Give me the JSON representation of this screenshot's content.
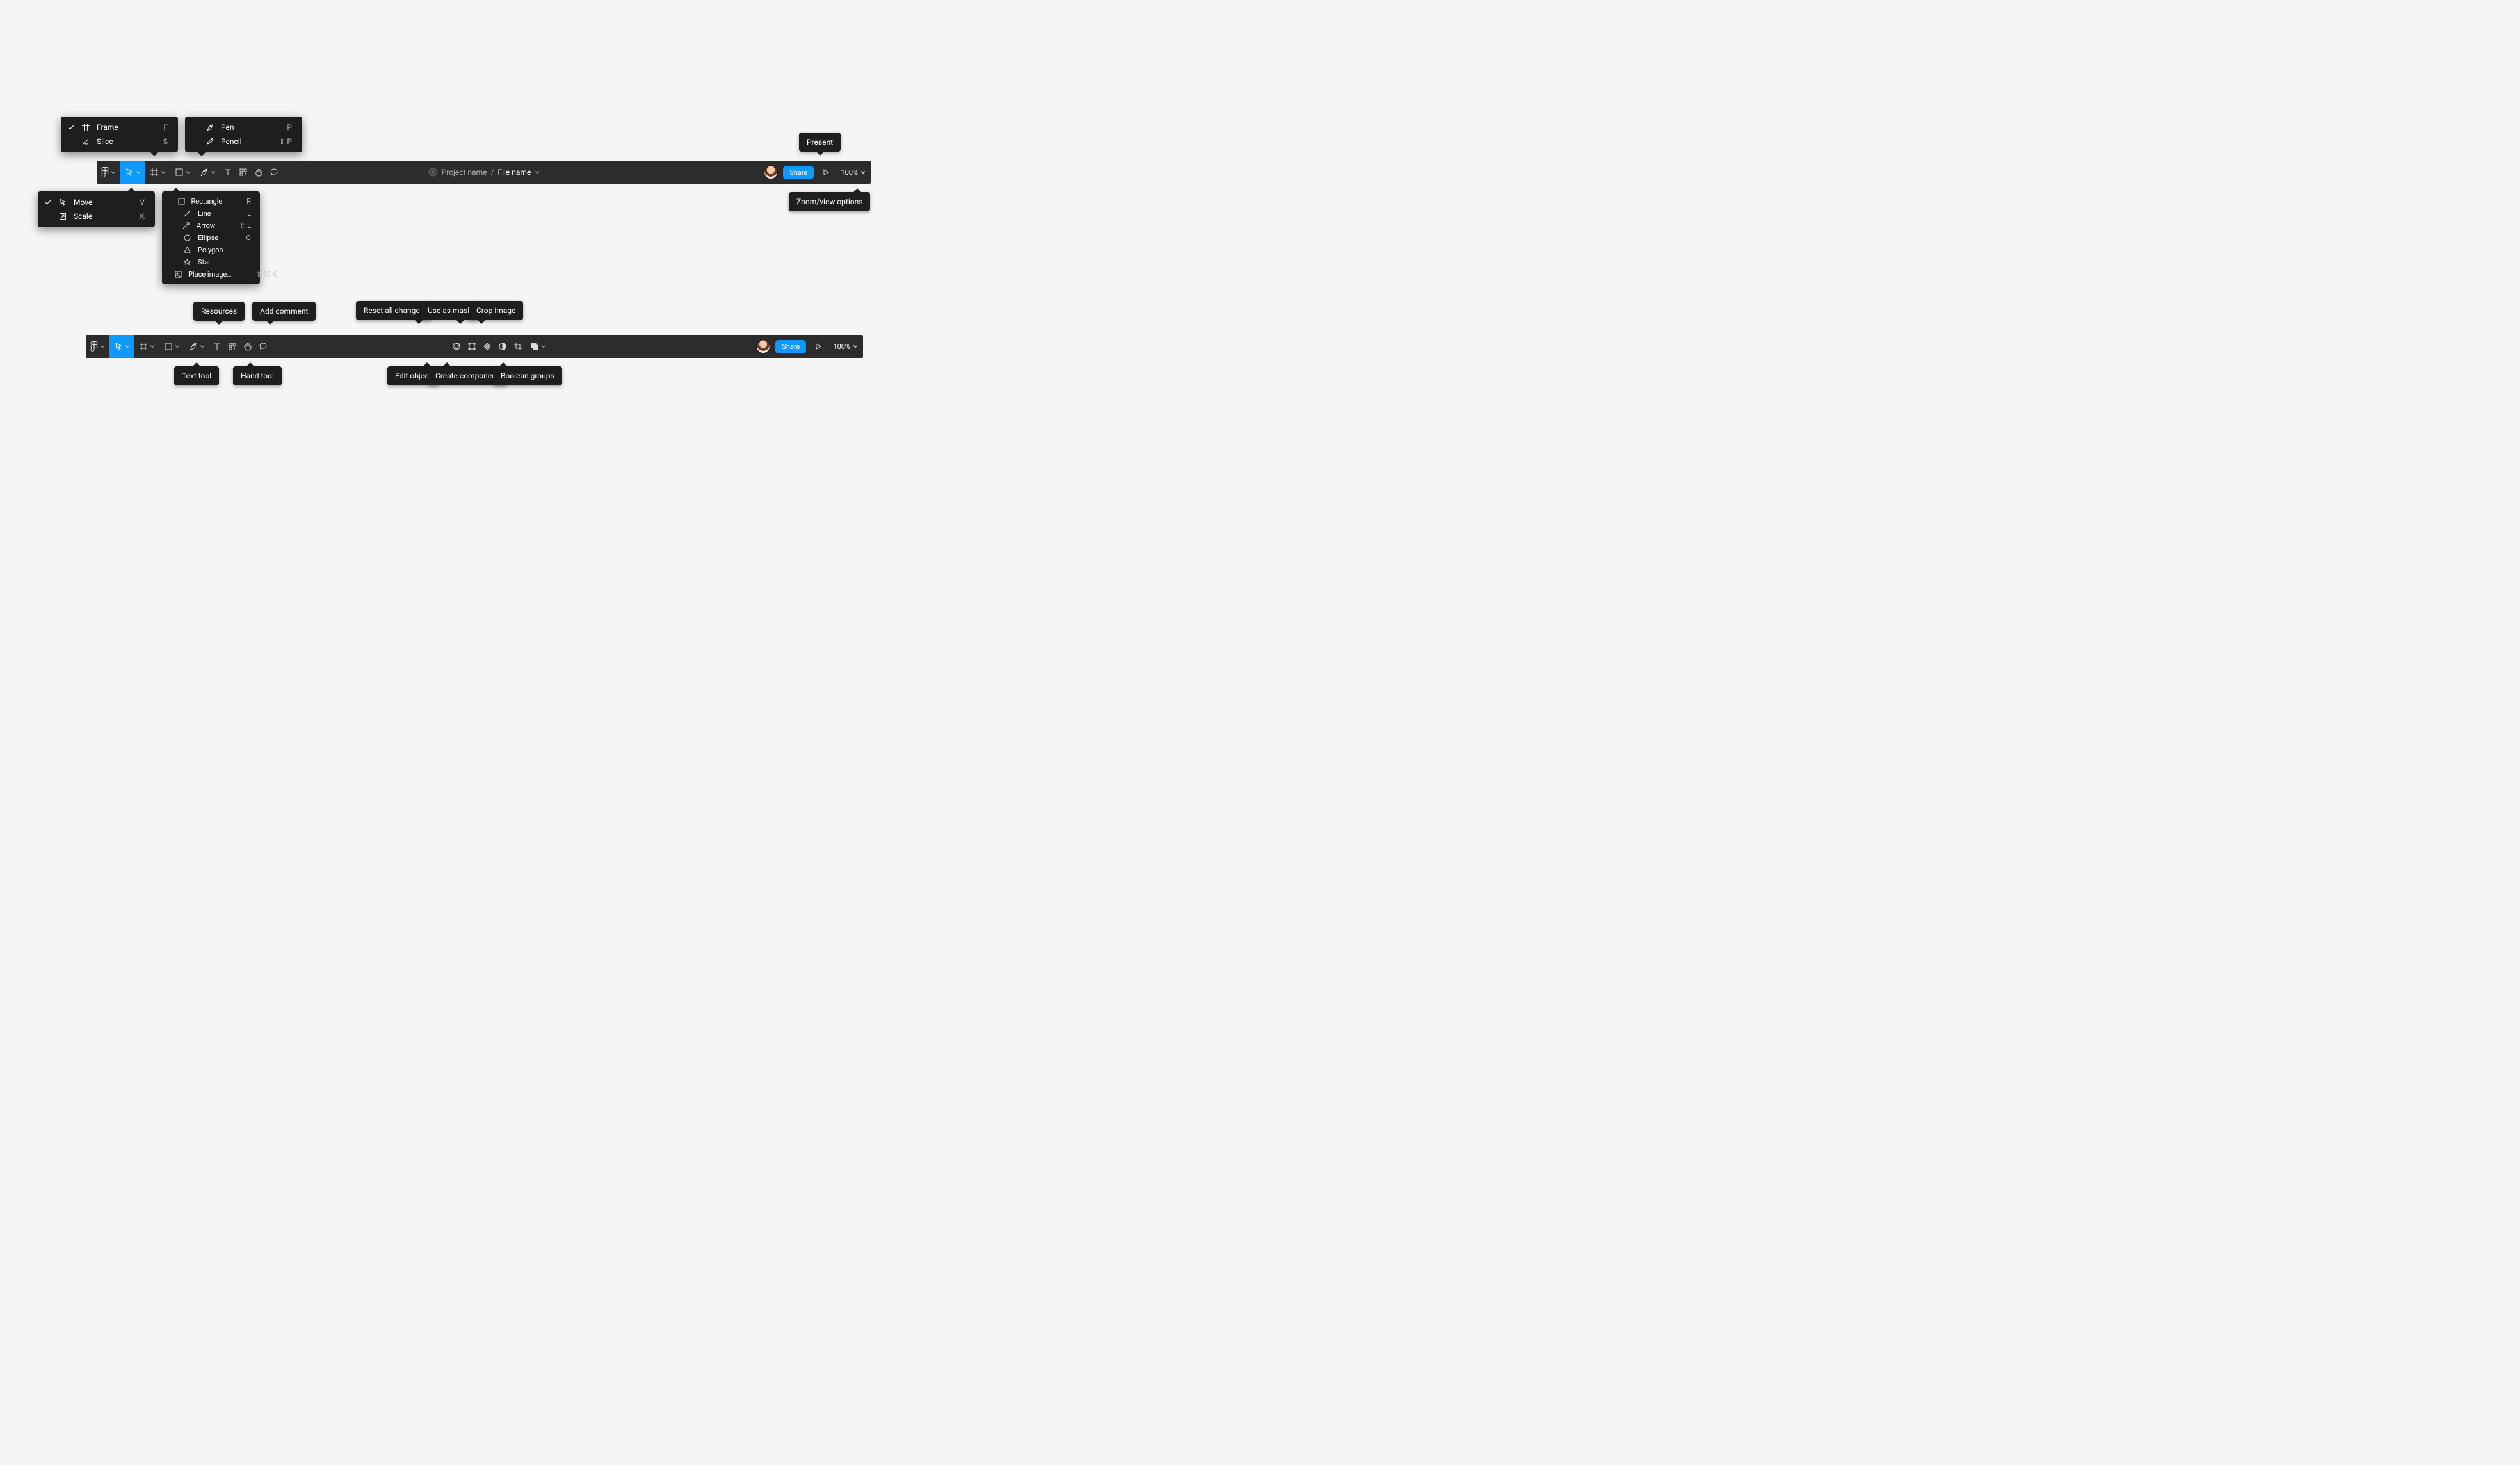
{
  "header": {
    "project_name": "Project name",
    "separator": "/",
    "file_name": "File name"
  },
  "share_label": "Share",
  "zoom_label": "100%",
  "tooltips": {
    "present": "Present",
    "zoom_view": "Zoom/view options",
    "resources": "Resources",
    "add_comment": "Add comment",
    "text_tool": "Text tool",
    "hand_tool": "Hand tool",
    "reset_all": "Reset all changes",
    "use_as_mask": "Use as mask",
    "crop_image": "Crop image",
    "edit_object": "Edit object",
    "create_component": "Create component",
    "boolean_groups": "Boolean groups"
  },
  "menus": {
    "frame": [
      {
        "icon": "frame-icon",
        "label": "Frame",
        "shortcut": "F",
        "checked": true
      },
      {
        "icon": "slice-icon",
        "label": "Slice",
        "shortcut": "S",
        "checked": false
      }
    ],
    "pen": [
      {
        "icon": "pen-icon",
        "label": "Pen",
        "shortcut": "P",
        "checked": false
      },
      {
        "icon": "pencil-icon",
        "label": "Pencil",
        "shortcut": "⇧ P",
        "checked": false
      }
    ],
    "move": [
      {
        "icon": "pointer-icon",
        "label": "Move",
        "shortcut": "V",
        "checked": true
      },
      {
        "icon": "scale-icon",
        "label": "Scale",
        "shortcut": "K",
        "checked": false
      }
    ],
    "shapes": [
      {
        "icon": "rectangle-icon",
        "label": "Rectangle",
        "shortcut": "R"
      },
      {
        "icon": "line-icon",
        "label": "Line",
        "shortcut": "L"
      },
      {
        "icon": "arrow-icon",
        "label": "Arrow",
        "shortcut": "⇧ L"
      },
      {
        "icon": "ellipse-icon",
        "label": "Ellipse",
        "shortcut": "O"
      },
      {
        "icon": "polygon-icon",
        "label": "Polygon",
        "shortcut": ""
      },
      {
        "icon": "star-icon",
        "label": "Star",
        "shortcut": ""
      },
      {
        "icon": "place-image-icon",
        "label": "Place image…",
        "shortcut": "⇧ ⌘ K"
      }
    ]
  }
}
